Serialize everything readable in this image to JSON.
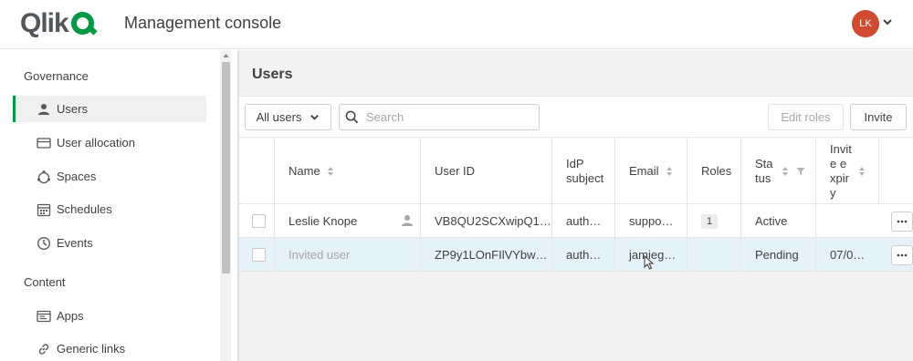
{
  "header": {
    "logo": "Qlik",
    "title": "Management console",
    "avatar_initials": "LK",
    "avatar_color": "#d04a30"
  },
  "sidebar": {
    "sections": [
      {
        "title": "Governance",
        "items": [
          {
            "label": "Users",
            "icon": "user-icon",
            "active": true
          },
          {
            "label": "User allocation",
            "icon": "card-icon"
          },
          {
            "label": "Spaces",
            "icon": "spaces-icon"
          },
          {
            "label": "Schedules",
            "icon": "calendar-icon"
          },
          {
            "label": "Events",
            "icon": "clock-icon"
          }
        ]
      },
      {
        "title": "Content",
        "items": [
          {
            "label": "Apps",
            "icon": "apps-icon"
          },
          {
            "label": "Generic links",
            "icon": "link-icon"
          }
        ]
      }
    ]
  },
  "main": {
    "title": "Users",
    "filter_label": "All users",
    "search_placeholder": "Search",
    "edit_roles_label": "Edit roles",
    "invite_label": "Invite",
    "columns": [
      "Name",
      "User ID",
      "IdP subject",
      "Email",
      "Roles",
      "Status",
      "Invite expiry"
    ],
    "rows": [
      {
        "name": "Leslie Knope",
        "user_id": "VB8QU2SCXwipQ1…",
        "idp_subject": "auth…",
        "email": "suppo…",
        "roles": "1",
        "status": "Active",
        "invite_expiry": ""
      },
      {
        "name": "Invited user",
        "user_id": "ZP9y1LOnFIlVYbw…",
        "idp_subject": "auth…",
        "email": "jamieg…",
        "roles": "",
        "status": "Pending",
        "invite_expiry": "07/0…"
      }
    ]
  },
  "colors": {
    "accent": "#009845",
    "selected_row": "#e5f2fa"
  }
}
